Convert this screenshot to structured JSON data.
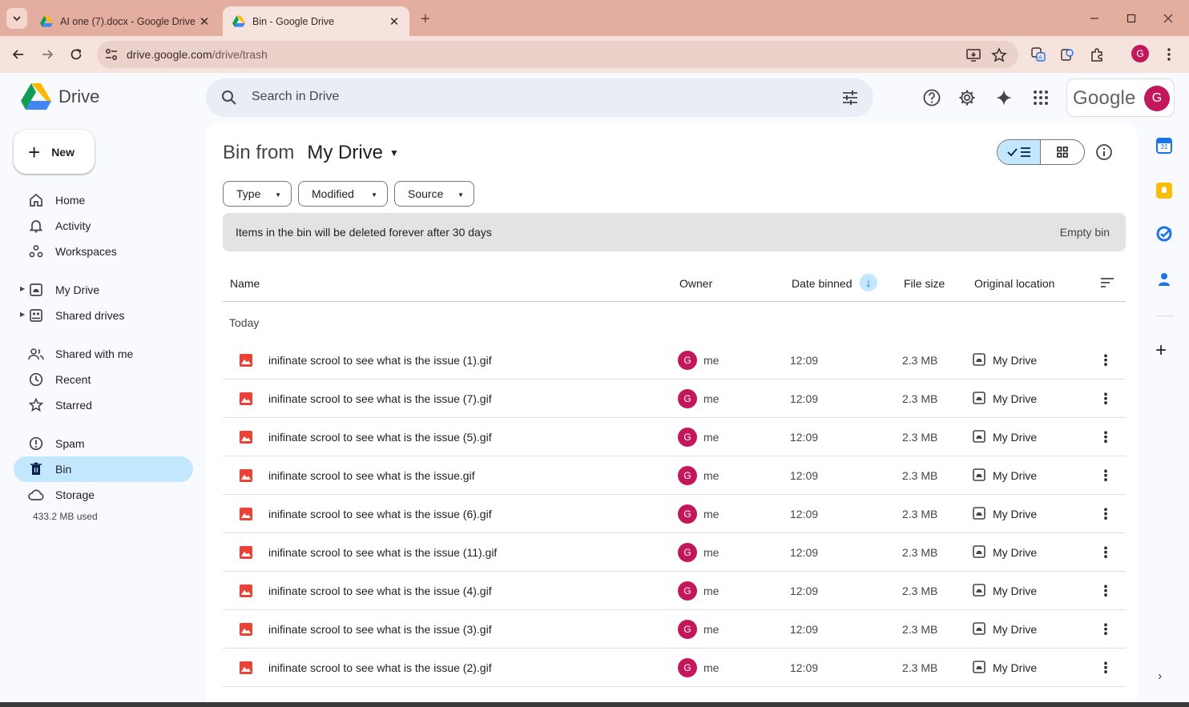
{
  "browser": {
    "tabs": [
      {
        "label": "AI one (7).docx - Google Drive",
        "active": false
      },
      {
        "label": "Bin - Google Drive",
        "active": true
      }
    ],
    "url_host": "drive.google.com",
    "url_path": "/drive/trash",
    "profile_initial": "G",
    "accent": "#e3aea0"
  },
  "app": {
    "name": "Drive",
    "search_placeholder": "Search in Drive",
    "google_wordmark": "Google",
    "avatar_initial": "G"
  },
  "sidebar": {
    "new_label": "New",
    "items": [
      {
        "label": "Home",
        "icon": "home-icon"
      },
      {
        "label": "Activity",
        "icon": "bell-icon"
      },
      {
        "label": "Workspaces",
        "icon": "workspaces-icon"
      },
      {
        "label": "My Drive",
        "icon": "my-drive-icon"
      },
      {
        "label": "Shared drives",
        "icon": "shared-drives-icon"
      },
      {
        "label": "Shared with me",
        "icon": "people-icon"
      },
      {
        "label": "Recent",
        "icon": "clock-icon"
      },
      {
        "label": "Starred",
        "icon": "star-icon"
      },
      {
        "label": "Spam",
        "icon": "spam-icon"
      },
      {
        "label": "Bin",
        "icon": "bin-icon"
      },
      {
        "label": "Storage",
        "icon": "cloud-icon"
      }
    ],
    "active_item": "Bin",
    "storage_used": "433.2 MB used"
  },
  "main": {
    "title_prefix": "Bin from",
    "title_location": "My Drive",
    "filters": [
      "Type",
      "Modified",
      "Source"
    ],
    "banner_text": "Items in the bin will be deleted forever after 30 days",
    "banner_action": "Empty bin",
    "columns": {
      "name": "Name",
      "owner": "Owner",
      "date": "Date binned",
      "size": "File size",
      "location": "Original location"
    },
    "group_label": "Today",
    "rows": [
      {
        "name": "inifinate scrool to see what is the issue (1).gif",
        "owner": "me",
        "owner_initial": "G",
        "date": "12:09",
        "size": "2.3 MB",
        "location": "My Drive"
      },
      {
        "name": "inifinate scrool to see what is the issue (7).gif",
        "owner": "me",
        "owner_initial": "G",
        "date": "12:09",
        "size": "2.3 MB",
        "location": "My Drive"
      },
      {
        "name": "inifinate scrool to see what is the issue (5).gif",
        "owner": "me",
        "owner_initial": "G",
        "date": "12:09",
        "size": "2.3 MB",
        "location": "My Drive"
      },
      {
        "name": "inifinate scrool to see what is the issue.gif",
        "owner": "me",
        "owner_initial": "G",
        "date": "12:09",
        "size": "2.3 MB",
        "location": "My Drive"
      },
      {
        "name": "inifinate scrool to see what is the issue (6).gif",
        "owner": "me",
        "owner_initial": "G",
        "date": "12:09",
        "size": "2.3 MB",
        "location": "My Drive"
      },
      {
        "name": "inifinate scrool to see what is the issue (11).gif",
        "owner": "me",
        "owner_initial": "G",
        "date": "12:09",
        "size": "2.3 MB",
        "location": "My Drive"
      },
      {
        "name": "inifinate scrool to see what is the issue (4).gif",
        "owner": "me",
        "owner_initial": "G",
        "date": "12:09",
        "size": "2.3 MB",
        "location": "My Drive"
      },
      {
        "name": "inifinate scrool to see what is the issue (3).gif",
        "owner": "me",
        "owner_initial": "G",
        "date": "12:09",
        "size": "2.3 MB",
        "location": "My Drive"
      },
      {
        "name": "inifinate scrool to see what is the issue (2).gif",
        "owner": "me",
        "owner_initial": "G",
        "date": "12:09",
        "size": "2.3 MB",
        "location": "My Drive"
      }
    ]
  },
  "side_panel": {
    "apps": [
      "calendar-icon",
      "keep-icon",
      "tasks-icon",
      "contacts-icon"
    ]
  }
}
